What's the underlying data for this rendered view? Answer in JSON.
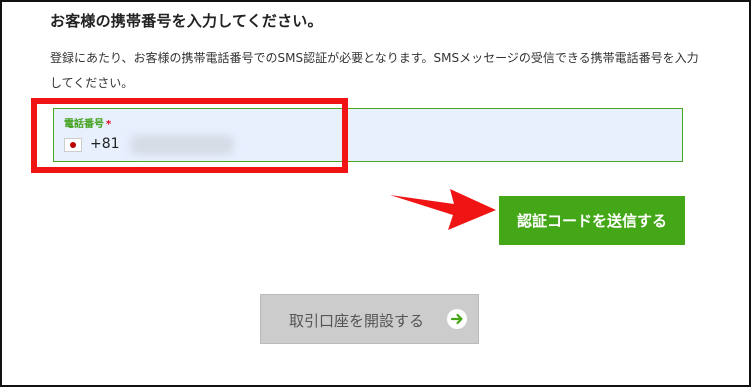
{
  "page": {
    "title": "お客様の携帯番号を入力してください。",
    "description": "登録にあたり、お客様の携帯電話番号でのSMS認証が必要となります。SMSメッセージの受信できる携帯電話番号を入力してください。"
  },
  "phone_field": {
    "label": "電話番号",
    "required_mark": "*",
    "country_flag": "japan-flag",
    "dial_code": "+81"
  },
  "buttons": {
    "send_code": "認証コードを送信する",
    "open_account": "取引口座を開設する"
  },
  "colors": {
    "accent_green": "#44a718",
    "highlight_red": "#f01414",
    "field_background": "#e8f0fe",
    "disabled_button": "#cccccc"
  }
}
